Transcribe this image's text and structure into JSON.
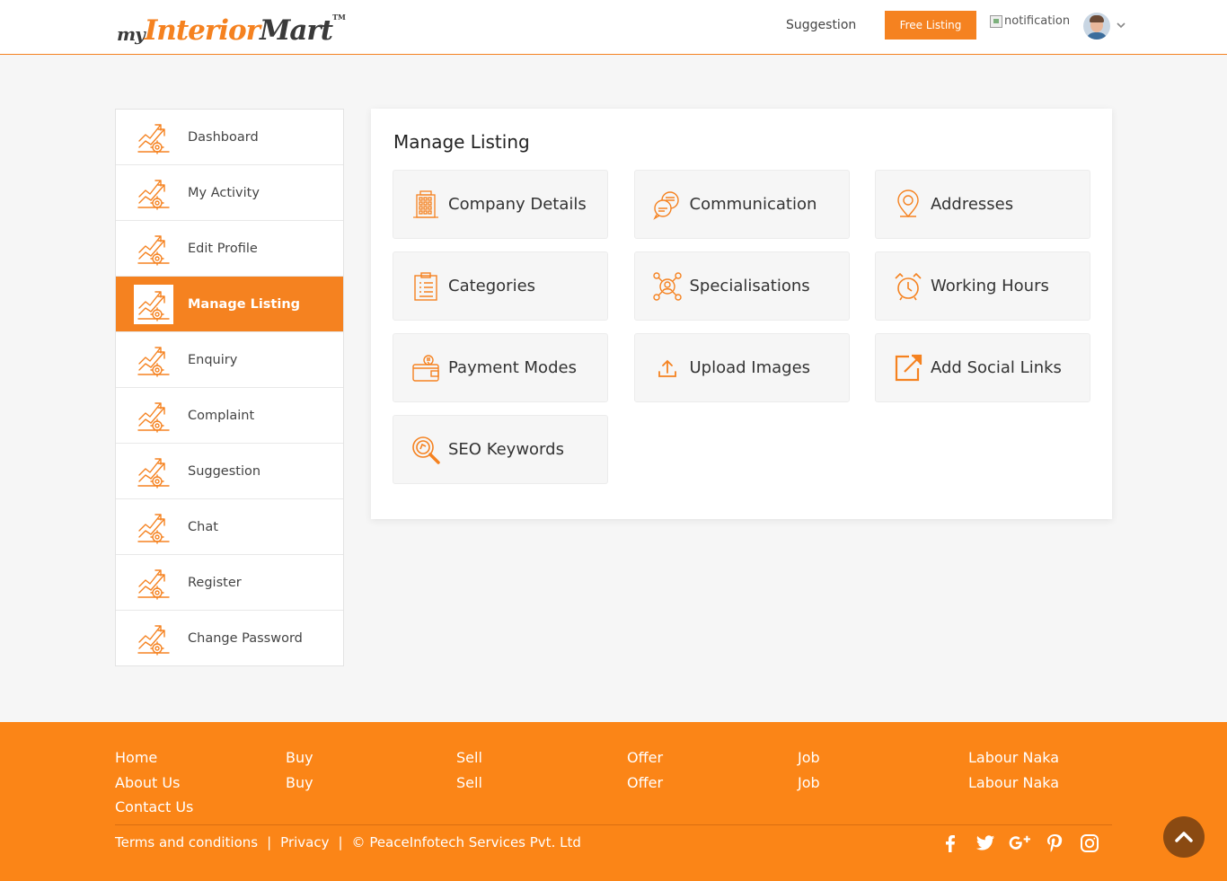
{
  "header": {
    "logo": {
      "my": "my",
      "interior": "Interior",
      "mart": "Mart",
      "tm": "TM"
    },
    "suggestion_label": "Suggestion",
    "free_listing_label": "Free Listing",
    "notification_alt": "notification",
    "user_menu_icon": "chevron-down-icon"
  },
  "sidebar": {
    "items": [
      {
        "label": "Dashboard",
        "icon": "growth-chart-icon",
        "active": false
      },
      {
        "label": "My Activity",
        "icon": "growth-chart-icon",
        "active": false
      },
      {
        "label": "Edit Profile",
        "icon": "growth-chart-icon",
        "active": false
      },
      {
        "label": "Manage Listing",
        "icon": "growth-chart-icon",
        "active": true
      },
      {
        "label": "Enquiry",
        "icon": "growth-chart-icon",
        "active": false
      },
      {
        "label": "Complaint",
        "icon": "growth-chart-icon",
        "active": false
      },
      {
        "label": "Suggestion",
        "icon": "growth-chart-icon",
        "active": false
      },
      {
        "label": "Chat",
        "icon": "growth-chart-icon",
        "active": false
      },
      {
        "label": "Register",
        "icon": "growth-chart-icon",
        "active": false
      },
      {
        "label": "Change Password",
        "icon": "growth-chart-icon",
        "active": false
      }
    ]
  },
  "main": {
    "title": "Manage Listing",
    "tiles": [
      {
        "label": "Company Details",
        "icon": "building-icon"
      },
      {
        "label": "Communication",
        "icon": "chat-bubbles-icon"
      },
      {
        "label": "Addresses",
        "icon": "map-pin-icon"
      },
      {
        "label": "Categories",
        "icon": "clipboard-icon"
      },
      {
        "label": "Specialisations",
        "icon": "network-person-icon"
      },
      {
        "label": "Working Hours",
        "icon": "alarm-clock-icon"
      },
      {
        "label": "Payment Modes",
        "icon": "wallet-icon"
      },
      {
        "label": "Upload Images",
        "icon": "upload-icon"
      },
      {
        "label": "Add Social Links",
        "icon": "external-link-icon"
      },
      {
        "label": "SEO Keywords",
        "icon": "seo-search-icon"
      }
    ]
  },
  "footer": {
    "columns": [
      [
        "Home",
        "About Us",
        "Contact Us"
      ],
      [
        "Buy",
        "Buy"
      ],
      [
        "Sell",
        "Sell"
      ],
      [
        "Offer",
        "Offer"
      ],
      [
        "Job",
        "Job"
      ],
      [
        "Labour Naka",
        "Labour Naka"
      ]
    ],
    "terms_label": "Terms and conditions",
    "privacy_label": "Privacy",
    "separator": "|",
    "copyright": "© PeaceInfotech Services Pvt. Ltd",
    "social": [
      "facebook-icon",
      "twitter-icon",
      "google-plus-icon",
      "pinterest-icon",
      "instagram-icon"
    ]
  },
  "colors": {
    "accent": "#f58220",
    "footer_bg": "#fb8517",
    "scroll_top_bg": "#8a4a12"
  }
}
